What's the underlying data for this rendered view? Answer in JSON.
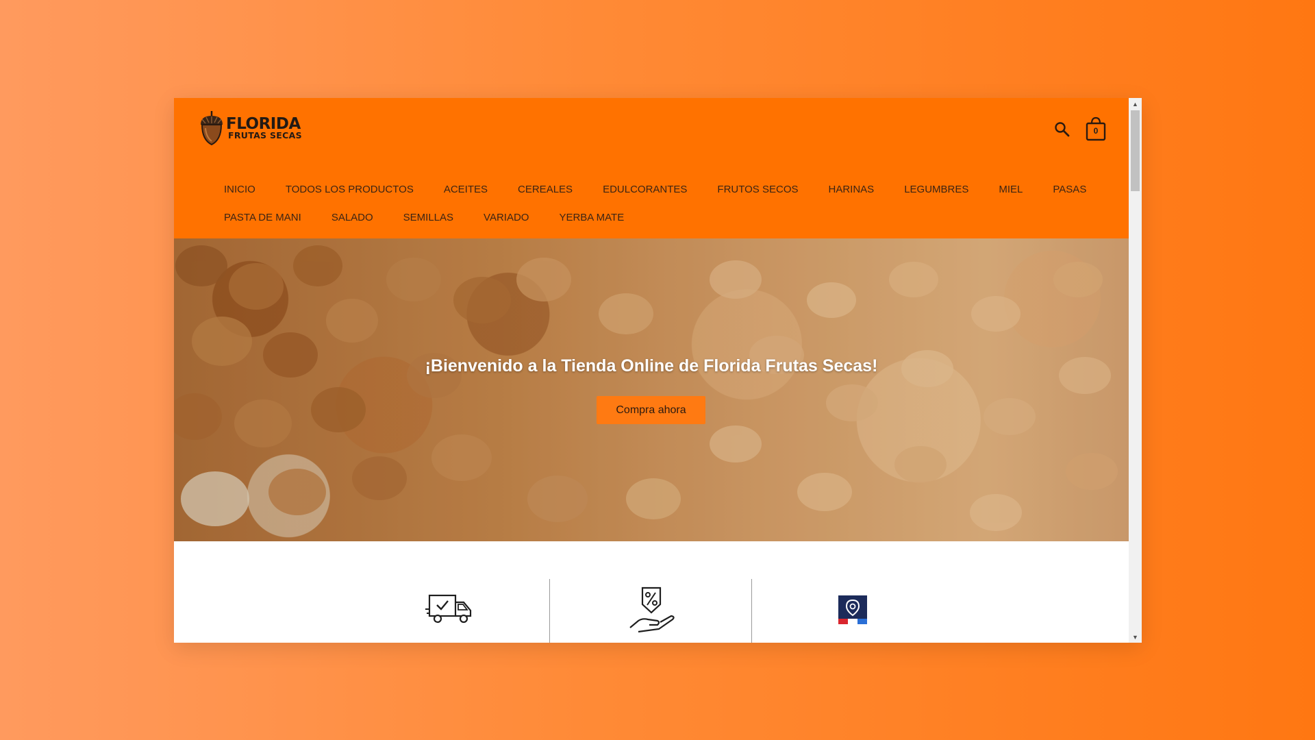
{
  "brand": {
    "name": "FLORIDA",
    "tagline": "FRUTAS SECAS",
    "accent_color": "#ff7200"
  },
  "header": {
    "search_icon": "search-icon",
    "cart_icon": "shopping-bag-icon",
    "cart_count": "0"
  },
  "nav": {
    "row1": [
      "INICIO",
      "TODOS LOS PRODUCTOS",
      "ACEITES",
      "CEREALES",
      "EDULCORANTES",
      "FRUTOS SECOS",
      "HARINAS",
      "LEGUMBRES",
      "MIEL",
      "PASAS"
    ],
    "row2": [
      "PASTA DE MANI",
      "SALADO",
      "SEMILLAS",
      "VARIADO",
      "YERBA MATE"
    ]
  },
  "hero": {
    "title": "¡Bienvenido a la Tienda Online de Florida Frutas Secas!",
    "button_label": "Compra ahora"
  },
  "features": {
    "icons": [
      "delivery-truck-icon",
      "discount-hand-icon",
      "location-pin-icon"
    ]
  },
  "scrollbar": {
    "up_glyph": "▲",
    "down_glyph": "▼"
  }
}
